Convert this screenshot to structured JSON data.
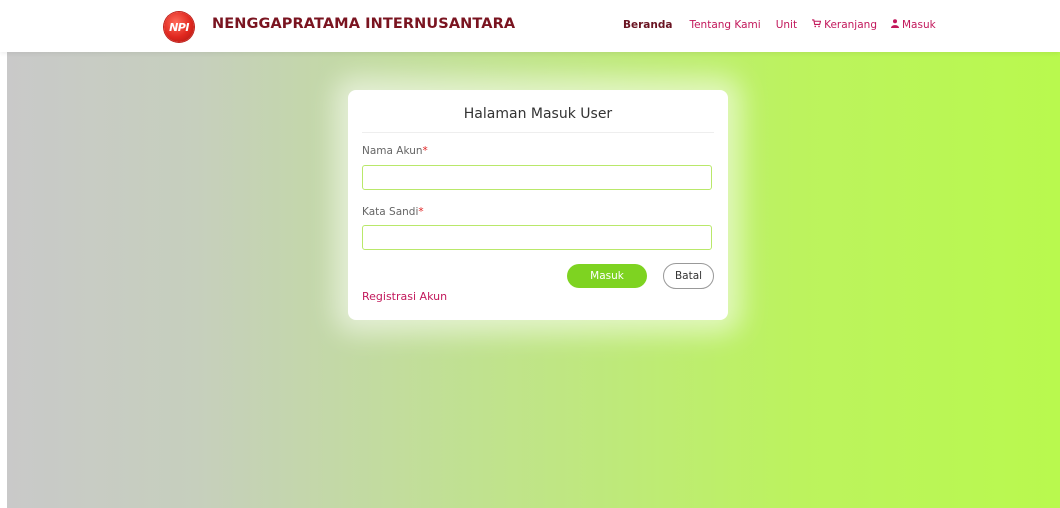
{
  "brand": {
    "logo_text": "NPI",
    "name": "NENGGAPRATAMA INTERNUSANTARA"
  },
  "nav": {
    "items": [
      {
        "label": "Beranda"
      },
      {
        "label": "Tentang Kami"
      },
      {
        "label": "Unit"
      },
      {
        "label": "Keranjang",
        "icon": "cart-icon"
      },
      {
        "label": "Masuk",
        "icon": "user-icon"
      }
    ]
  },
  "login_form": {
    "title": "Halaman Masuk User",
    "username_label": "Nama Akun",
    "username_value": "",
    "password_label": "Kata Sandi",
    "password_value": "",
    "required_marker": "*",
    "submit_label": "Masuk",
    "cancel_label": "Batal",
    "register_link": "Registrasi Akun"
  },
  "colors": {
    "brand": "#7a1420",
    "link": "#c2185b",
    "button_primary": "#7ed321",
    "gradient_start": "#c9c9c9",
    "gradient_end": "#b9f94e"
  }
}
